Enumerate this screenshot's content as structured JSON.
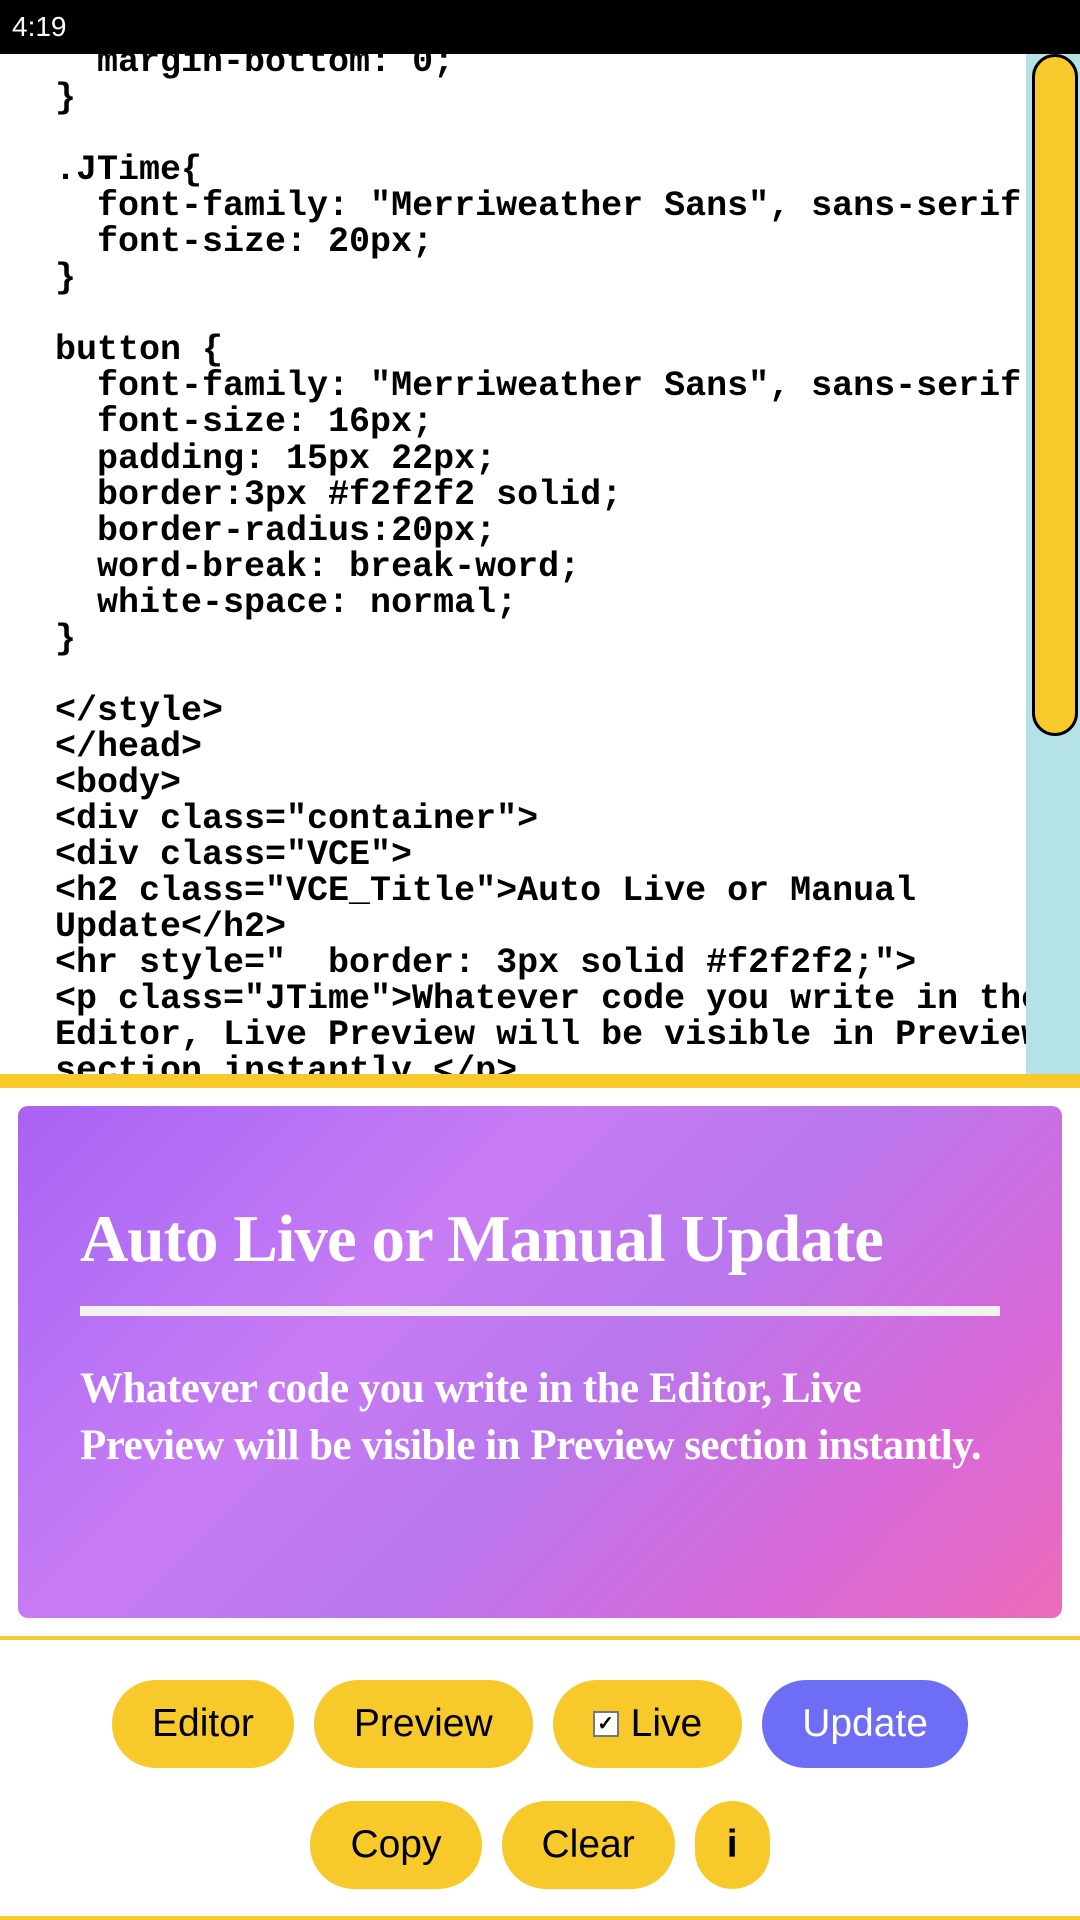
{
  "status_bar": {
    "time": "4:19"
  },
  "editor": {
    "code": "  margin-bottom: 0;\n}\n\n.JTime{\n  font-family: \"Merriweather Sans\", sans-serif;\n  font-size: 20px;\n}\n\nbutton {\n  font-family: \"Merriweather Sans\", sans-serif;\n  font-size: 16px;\n  padding: 15px 22px;\n  border:3px #f2f2f2 solid;\n  border-radius:20px;\n  word-break: break-word;\n  white-space: normal;\n}\n\n</style>\n</head>\n<body>\n<div class=\"container\">\n<div class=\"VCE\">\n<h2 class=\"VCE_Title\">Auto Live or Manual Update</h2>\n<hr style=\"  border: 3px solid #f2f2f2;\">\n<p class=\"JTime\">Whatever code you write in the Editor, Live Preview will be visible in Preview section instantly.</p>"
  },
  "preview": {
    "title": "Auto Live or Manual Update",
    "text": "Whatever code you write in the Editor, Live Preview will be visible in Preview section instantly."
  },
  "toolbar": {
    "editor_label": "Editor",
    "preview_label": "Preview",
    "live_label": "Live",
    "live_checked": true,
    "update_label": "Update",
    "copy_label": "Copy",
    "clear_label": "Clear",
    "info_label": "i"
  }
}
